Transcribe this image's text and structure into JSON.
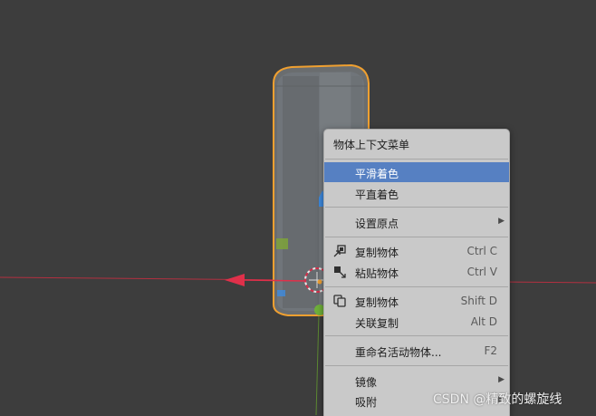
{
  "context_menu": {
    "title": "物体上下文菜单",
    "items": [
      {
        "label": "平滑着色",
        "shortcut": "",
        "icon": "",
        "submenu": false,
        "highlighted": true
      },
      {
        "label": "平直着色",
        "shortcut": "",
        "icon": "",
        "submenu": false,
        "highlighted": false
      },
      {
        "label": "设置原点",
        "shortcut": "",
        "icon": "",
        "submenu": true,
        "highlighted": false
      },
      {
        "label": "复制物体",
        "shortcut": "Ctrl C",
        "icon": "copy-object-icon",
        "submenu": false,
        "highlighted": false
      },
      {
        "label": "粘贴物体",
        "shortcut": "Ctrl V",
        "icon": "paste-object-icon",
        "submenu": false,
        "highlighted": false
      },
      {
        "label": "复制物体",
        "shortcut": "Shift D",
        "icon": "duplicate-icon",
        "submenu": false,
        "highlighted": false
      },
      {
        "label": "关联复制",
        "shortcut": "Alt D",
        "icon": "",
        "submenu": false,
        "highlighted": false
      },
      {
        "label": "重命名活动物体...",
        "shortcut": "F2",
        "icon": "",
        "submenu": false,
        "highlighted": false
      },
      {
        "label": "镜像",
        "shortcut": "",
        "icon": "",
        "submenu": true,
        "highlighted": false
      },
      {
        "label": "吸附",
        "shortcut": "",
        "icon": "",
        "submenu": true,
        "highlighted": false
      }
    ]
  },
  "watermark": "CSDN @精致的螺旋线",
  "colors": {
    "viewport_bg": "#3d3d3d",
    "selection_outline": "#f0a030",
    "menu_bg": "#c9c9c9",
    "menu_highlight": "#5680c2",
    "x_axis": "#d0304a",
    "y_axis": "#6fa03a",
    "z_gizmo": "#3d8be0"
  }
}
